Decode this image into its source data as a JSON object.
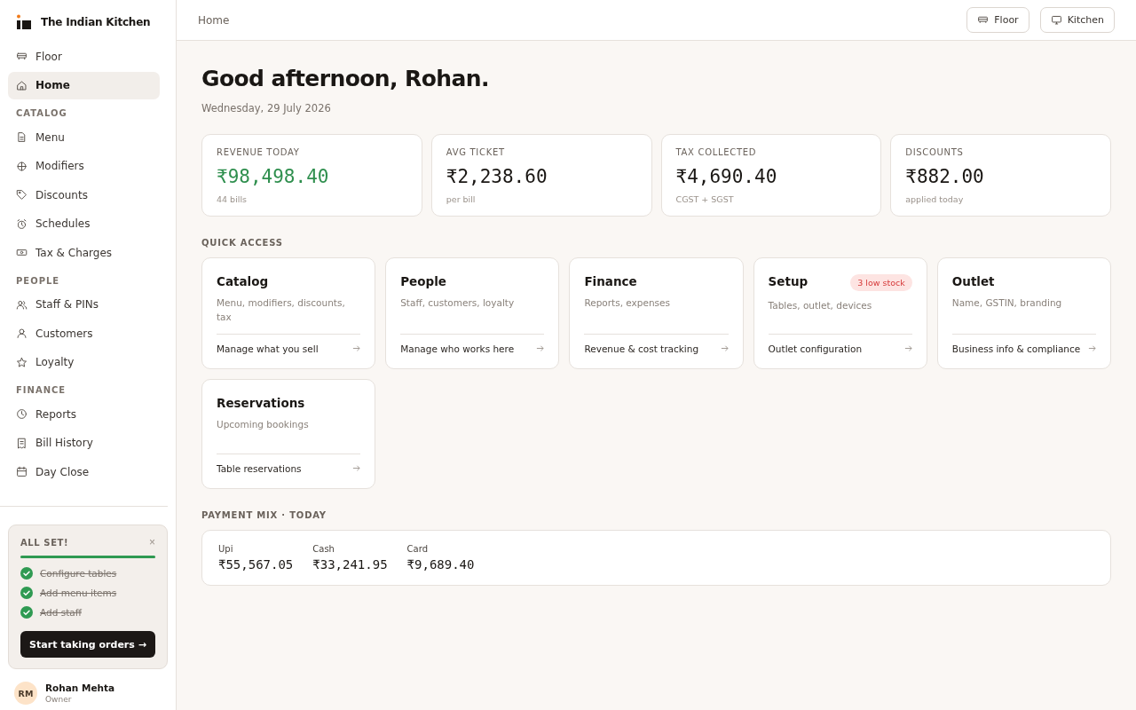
{
  "brand": {
    "name": "The Indian Kitchen"
  },
  "sidebar": {
    "items": [
      {
        "label": "Floor",
        "selected": false
      },
      {
        "label": "Home",
        "selected": true
      }
    ],
    "sections": [
      {
        "title": "CATALOG",
        "items": [
          {
            "label": "Menu",
            "selected": false
          },
          {
            "label": "Modifiers",
            "selected": false
          },
          {
            "label": "Discounts",
            "selected": false
          },
          {
            "label": "Schedules",
            "selected": false
          },
          {
            "label": "Tax & Charges",
            "selected": false
          }
        ]
      },
      {
        "title": "PEOPLE",
        "items": [
          {
            "label": "Staff & PINs",
            "selected": false
          },
          {
            "label": "Customers",
            "selected": false
          },
          {
            "label": "Loyalty",
            "selected": false
          }
        ]
      },
      {
        "title": "FINANCE",
        "items": [
          {
            "label": "Reports",
            "selected": false
          },
          {
            "label": "Bill History",
            "selected": false
          },
          {
            "label": "Day Close",
            "selected": false
          }
        ]
      }
    ]
  },
  "setup_card": {
    "title": "ALL SET!",
    "close": "×",
    "level": 1,
    "tasks": [
      {
        "label": "Configure tables",
        "done": true
      },
      {
        "label": "Add menu items",
        "done": true
      },
      {
        "label": "Add staff",
        "done": true
      }
    ],
    "button": "Start taking orders →"
  },
  "user": {
    "initials": "RM",
    "name": "Rohan Mehta",
    "role": "Owner"
  },
  "topbar": {
    "breadcrumb": "Home",
    "buttons": [
      "Floor",
      "Kitchen"
    ]
  },
  "greeting": "Good afternoon, Rohan.",
  "date": "Wednesday, 29 July 2026",
  "stats": [
    {
      "label": "REVENUE TODAY",
      "value": "₹98,498.40",
      "sub": "44 bills",
      "color": "#2f8f4e"
    },
    {
      "label": "AVG TICKET",
      "value": "₹2,238.60",
      "sub": "per bill",
      "color": "#1a1714"
    },
    {
      "label": "TAX COLLECTED",
      "value": "₹4,690.40",
      "sub": "CGST + SGST",
      "color": "#1a1714"
    },
    {
      "label": "DISCOUNTS",
      "value": "₹882.00",
      "sub": "applied today",
      "color": "#1a1714"
    }
  ],
  "quick_access": {
    "title": "QUICK ACCESS",
    "cards": [
      {
        "title": "Catalog",
        "description": "Menu, modifiers, discounts, tax",
        "link": "Manage what you sell"
      },
      {
        "title": "People",
        "description": "Staff, customers, loyalty",
        "link": "Manage who works here"
      },
      {
        "title": "Finance",
        "description": "Reports, expenses",
        "link": "Revenue & cost tracking"
      },
      {
        "title": "Setup",
        "description": "Tables, outlet, devices",
        "link": "Outlet configuration",
        "badge": "3 low stock"
      },
      {
        "title": "Outlet",
        "description": "Name, GSTIN, branding",
        "link": "Business info & compliance"
      },
      {
        "title": "Reservations",
        "description": "Upcoming bookings",
        "link": "Table reservations"
      }
    ]
  },
  "payment_mix": {
    "title": "PAYMENT MIX · TODAY",
    "items": [
      {
        "label": "Upi",
        "value": "₹55,567.05"
      },
      {
        "label": "Cash",
        "value": "₹33,241.95"
      },
      {
        "label": "Card",
        "value": "₹9,689.40"
      }
    ]
  }
}
